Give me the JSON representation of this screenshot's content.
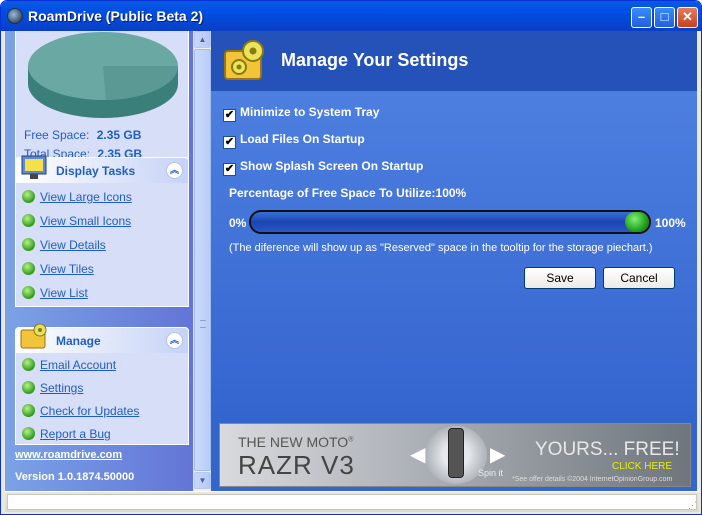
{
  "window": {
    "title": "RoamDrive (Public Beta 2)",
    "controls": {
      "minimize": "–",
      "maximize": "□",
      "close": "✕"
    }
  },
  "sidebar": {
    "free_space_label": "Free Space:",
    "free_space_value": "2.35 GB",
    "total_space_label": "Total Space:",
    "total_space_value": "2.35 GB",
    "display_tasks": {
      "title": "Display Tasks",
      "items": [
        {
          "label": "View Large Icons"
        },
        {
          "label": "View Small Icons"
        },
        {
          "label": "View Details"
        },
        {
          "label": "View Tiles"
        },
        {
          "label": "View List"
        }
      ]
    },
    "manage": {
      "title": "Manage",
      "items": [
        {
          "label": "Email Account"
        },
        {
          "label": "Settings"
        },
        {
          "label": "Check for Updates"
        },
        {
          "label": "Report a Bug"
        }
      ]
    },
    "website": "www.roamdrive.com",
    "version": "Version 1.0.1874.50000",
    "collapse_glyph": "︽"
  },
  "settings": {
    "title": "Manage Your Settings",
    "options": [
      {
        "label": "Minimize to System Tray",
        "checked": true
      },
      {
        "label": "Load Files On Startup",
        "checked": true
      },
      {
        "label": "Show Splash Screen On Startup",
        "checked": true
      }
    ],
    "check_glyph": "✔",
    "percentage_label": "Percentage of Free Space To Utilize:",
    "percentage_value": "100%",
    "slider_min_label": "0%",
    "slider_max_label": "100%",
    "slider_level": 1.0,
    "note": "(The diference will show up as \"Reserved\" space in the tooltip for the storage piechart.)",
    "save_label": "Save",
    "cancel_label": "Cancel"
  },
  "ad": {
    "line1": "THE NEW MOTO",
    "line1_sup": "®",
    "line2": "RAZR V3",
    "spin": "Spin it",
    "yours": "YOURS... FREE!",
    "click": "CLICK HERE",
    "fine": "*See offer details  ©2004 InternetOpinionGroup.com"
  },
  "colors": {
    "accent": "#215dc6",
    "panel_blue": "#3366cc",
    "slider_thumb": "#22a020"
  },
  "icons": {
    "app": "roamdrive-icon",
    "settings": "gear-folder-icon",
    "display_tasks": "monitor-icon",
    "manage": "gear-folder-icon",
    "bullet": "green-bullet-icon"
  }
}
